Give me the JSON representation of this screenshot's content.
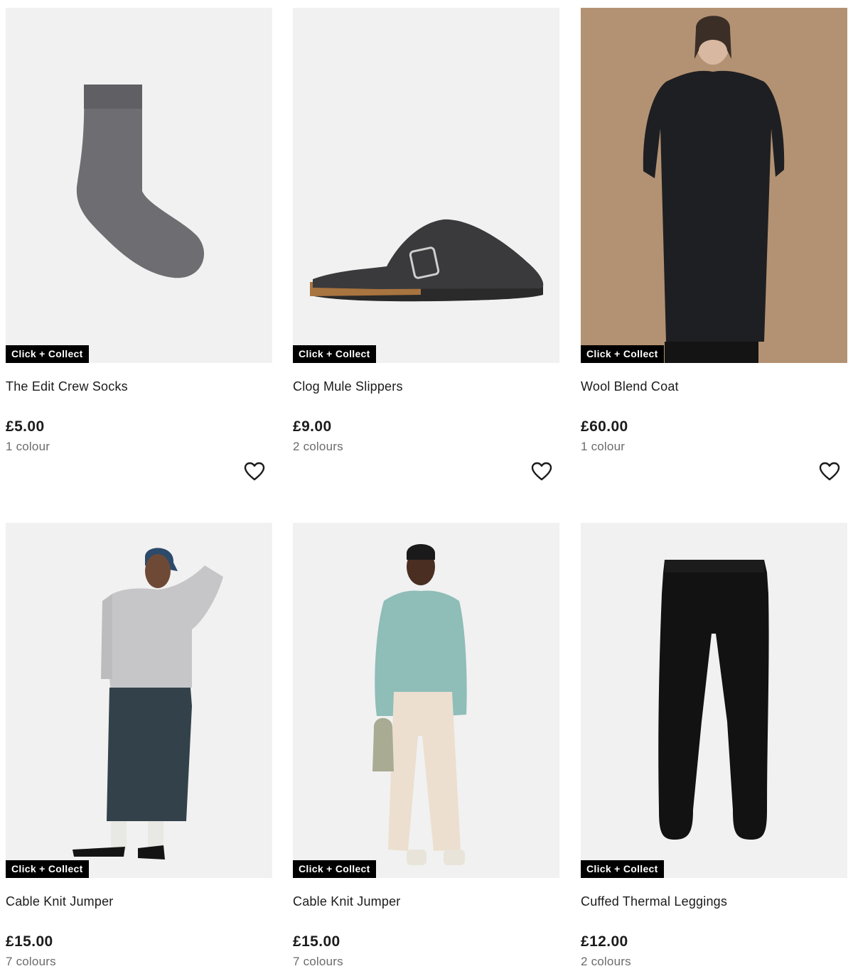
{
  "products": [
    {
      "title": "The Edit Crew Socks",
      "price": "£5.00",
      "colours": "1 colour",
      "badge": "Click + Collect",
      "image": "grey-sock",
      "wishlist_icon": "heart-icon"
    },
    {
      "title": "Clog Mule Slippers",
      "price": "£9.00",
      "colours": "2 colours",
      "badge": "Click + Collect",
      "image": "charcoal-clog-slipper",
      "wishlist_icon": "heart-icon"
    },
    {
      "title": "Wool Blend Coat",
      "price": "£60.00",
      "colours": "1 colour",
      "badge": "Click + Collect",
      "image": "model-black-wool-coat",
      "wishlist_icon": "heart-icon"
    },
    {
      "title": "Cable Knit Jumper",
      "price": "£15.00",
      "colours": "7 colours",
      "badge": "Click + Collect",
      "image": "model-grey-cable-jumper",
      "wishlist_icon": "heart-icon"
    },
    {
      "title": "Cable Knit Jumper",
      "price": "£15.00",
      "colours": "7 colours",
      "badge": "Click + Collect",
      "image": "model-mint-cable-jumper",
      "wishlist_icon": "heart-icon"
    },
    {
      "title": "Cuffed Thermal Leggings",
      "price": "£12.00",
      "colours": "2 colours",
      "badge": "Click + Collect",
      "image": "black-leggings",
      "wishlist_icon": "heart-icon"
    }
  ],
  "colors": {
    "badge_bg": "#000000",
    "badge_text": "#ffffff",
    "price": "#1b1b1b",
    "muted": "#6b6b6b",
    "image_bg": "#f1f1f1",
    "coat_bg": "#b39273"
  }
}
